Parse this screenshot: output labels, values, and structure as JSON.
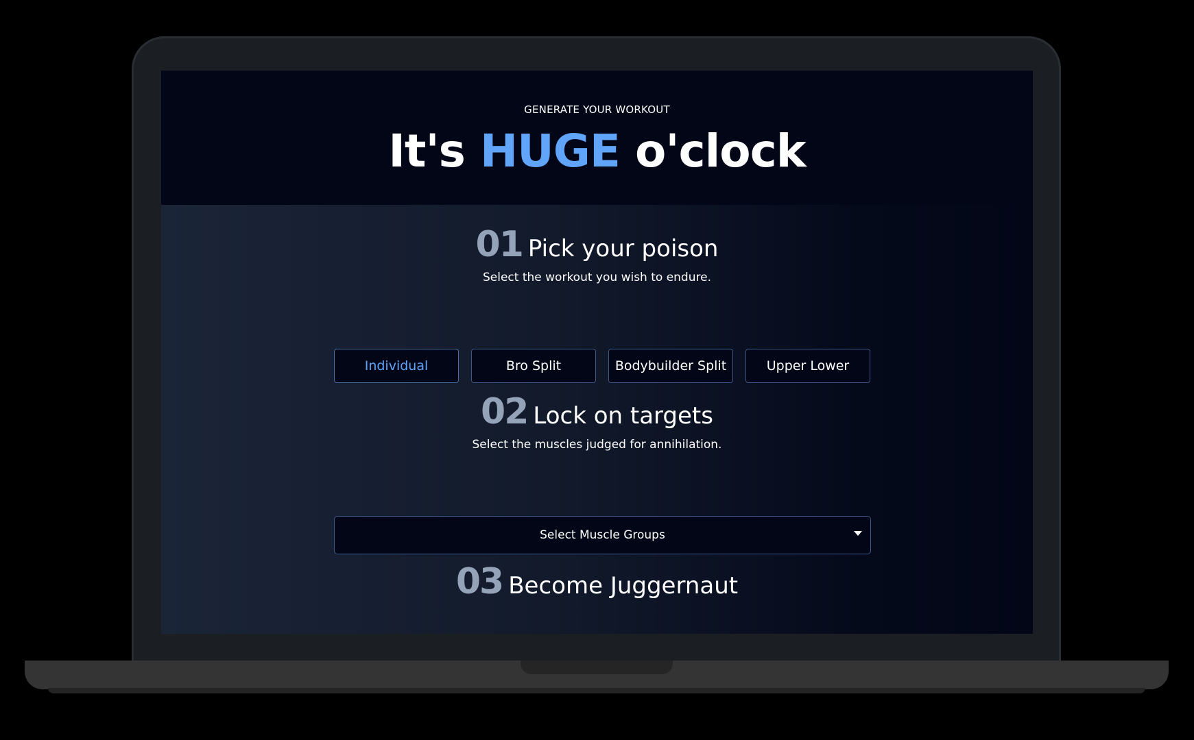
{
  "hero": {
    "eyebrow": "GENERATE YOUR WORKOUT",
    "headline_prefix": "It's ",
    "headline_accent": "HUGE",
    "headline_suffix": " o'clock"
  },
  "sections": [
    {
      "number": "01",
      "title": "Pick your poison",
      "subtitle": "Select the workout you wish to endure."
    },
    {
      "number": "02",
      "title": "Lock on targets",
      "subtitle": "Select the muscles judged for annihilation."
    },
    {
      "number": "03",
      "title": "Become Juggernaut"
    }
  ],
  "workout_options": [
    {
      "label": "Individual",
      "selected": true
    },
    {
      "label": "Bro Split",
      "selected": false
    },
    {
      "label": "Bodybuilder Split",
      "selected": false
    },
    {
      "label": "Upper Lower",
      "selected": false
    }
  ],
  "muscle_select": {
    "placeholder": "Select Muscle Groups",
    "icon": "caret-down-icon"
  },
  "colors": {
    "accent": "#60a5fa",
    "background": "#020617",
    "border": "#3b5a8a",
    "number": "#94a3b8"
  }
}
